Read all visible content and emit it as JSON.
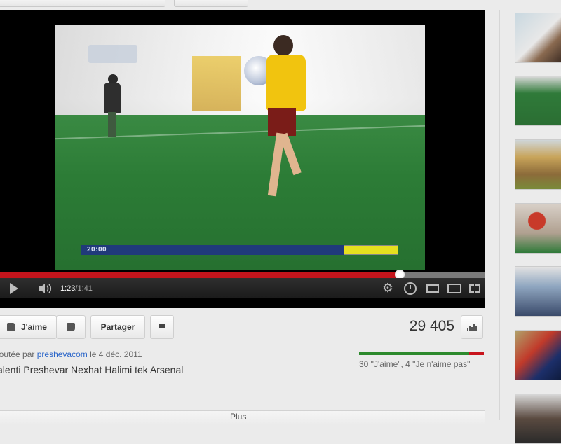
{
  "player": {
    "current_time": "1:23",
    "separator": " / ",
    "duration": "1:41",
    "progress_fraction": 0.823,
    "overlay_text": "20:00"
  },
  "actions": {
    "like_label": "J'aime",
    "share_label": "Partager",
    "view_count": "29 405"
  },
  "meta": {
    "added_by_prefix": "joutée par ",
    "uploader": "preshevacom",
    "date_prefix": " le  ",
    "date": "4 déc. 2011",
    "title": "alenti Preshevar Nexhat Halimi tek Arsenal",
    "rating_text": "30 \"J'aime\", 4 \"Je n'aime pas\"",
    "likes": 30,
    "dislikes": 4,
    "more_label": "Plus"
  },
  "colors": {
    "progress_played": "#c4141c",
    "like_bar": "#2d8a2d",
    "dislike_bar": "#c8141c",
    "link": "#2b66c9"
  },
  "icons": [
    "play-icon",
    "volume-icon",
    "settings-icon",
    "watch-later-icon",
    "small-player-icon",
    "large-player-icon",
    "fullscreen-icon",
    "thumbs-up-icon",
    "thumbs-down-icon",
    "flag-icon",
    "stats-icon"
  ]
}
